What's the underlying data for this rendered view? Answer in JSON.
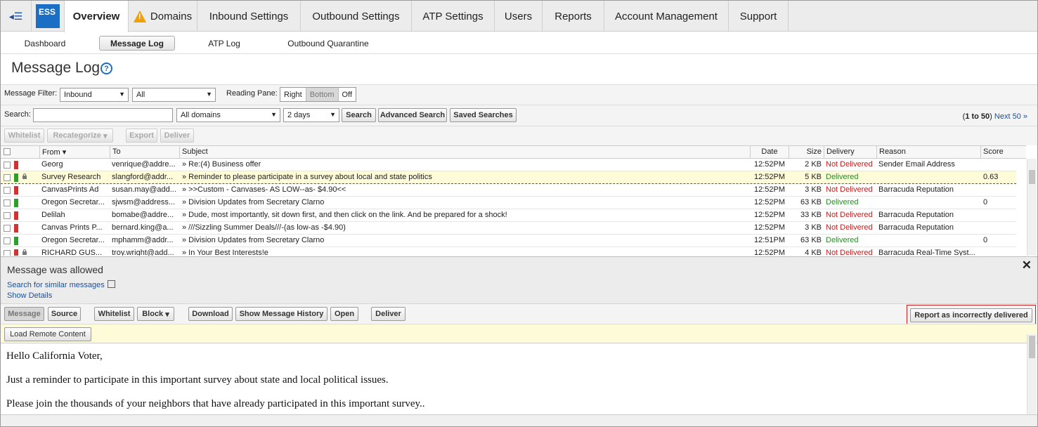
{
  "nav": {
    "logo": "ESS",
    "tabs": [
      "Overview",
      "Domains",
      "Inbound Settings",
      "Outbound Settings",
      "ATP Settings",
      "Users",
      "Reports",
      "Account Management",
      "Support"
    ]
  },
  "subnav": [
    "Dashboard",
    "Message Log",
    "ATP Log",
    "Outbound Quarantine"
  ],
  "page": {
    "title": "Message Log",
    "help": "?"
  },
  "filter": {
    "label": "Message Filter:",
    "direction": "Inbound",
    "status": "All",
    "reading_pane_label": "Reading Pane:",
    "reading_pane_options": [
      "Right",
      "Bottom",
      "Off"
    ]
  },
  "search": {
    "label": "Search:",
    "value": "",
    "domains": "All domains",
    "period": "2 days",
    "search_btn": "Search",
    "advanced_btn": "Advanced Search",
    "saved_btn": "Saved Searches",
    "range": "1 to 50",
    "next": "Next 50 »"
  },
  "actions": [
    "Whitelist",
    "Recategorize",
    "Export",
    "Deliver"
  ],
  "table": {
    "headers": [
      "From",
      "To",
      "Subject",
      "Date",
      "Size",
      "Delivery",
      "Reason",
      "Score"
    ],
    "rows": [
      {
        "from": "Georg",
        "to": "venrique@addre...",
        "subject": "» Re:(4) Business offer",
        "date": "12:52PM",
        "size": "2 KB",
        "delivery": "Not Delivered",
        "reason": "Sender Email Address",
        "score": ""
      },
      {
        "from": "Survey Research",
        "to": "slangford@addr...",
        "subject": "» Reminder to please participate in a survey about local and state politics",
        "date": "12:52PM",
        "size": "5 KB",
        "delivery": "Delivered",
        "reason": "",
        "score": "0.63"
      },
      {
        "from": "CanvasPrints Ad",
        "to": "susan.may@add...",
        "subject": "» >>Custom - Canvases- AS LOW--as- $4.90<<",
        "date": "12:52PM",
        "size": "3 KB",
        "delivery": "Not Delivered",
        "reason": "Barracuda Reputation",
        "score": ""
      },
      {
        "from": "Oregon Secretar...",
        "to": "sjwsm@address...",
        "subject": "» Division Updates from Secretary Clarno",
        "date": "12:52PM",
        "size": "63 KB",
        "delivery": "Delivered",
        "reason": "",
        "score": "0"
      },
      {
        "from": "Delilah",
        "to": "bomabe@addre...",
        "subject": "» Dude, most importantly, sit down first, and then click on the link. And be prepared for a shock!",
        "date": "12:52PM",
        "size": "33 KB",
        "delivery": "Not Delivered",
        "reason": "Barracuda Reputation",
        "score": ""
      },
      {
        "from": "Canvas Prints P...",
        "to": "bernard.king@a...",
        "subject": "» ///Sizzling Summer Deals///-(as low-as -$4.90)",
        "date": "12:52PM",
        "size": "3 KB",
        "delivery": "Not Delivered",
        "reason": "Barracuda Reputation",
        "score": ""
      },
      {
        "from": "Oregon Secretar...",
        "to": "mphamm@addr...",
        "subject": "» Division Updates from Secretary Clarno",
        "date": "12:51PM",
        "size": "63 KB",
        "delivery": "Delivered",
        "reason": "",
        "score": "0"
      },
      {
        "from": "RICHARD GUS...",
        "to": "troy.wright@add...",
        "subject": "» In Your Best Interests!e",
        "date": "12:52PM",
        "size": "4 KB",
        "delivery": "Not Delivered",
        "reason": "Barracuda Real-Time Syst...",
        "score": ""
      }
    ]
  },
  "reading_pane": {
    "status": "Message was allowed",
    "similar_link": "Search for similar messages",
    "details_link": "Show Details",
    "buttons": [
      "Message",
      "Source",
      "Whitelist",
      "Block",
      "Download",
      "Show Message History",
      "Open",
      "Deliver"
    ],
    "report_btn": "Report as incorrectly delivered",
    "load_remote": "Load Remote Content",
    "body": [
      "Hello California Voter,",
      "Just a reminder to participate in this important survey about  state and local political issues.",
      "Please join the thousands of  your neighbors that have already participated in this important survey.."
    ]
  },
  "colors": {
    "accent": "#1a6fc4",
    "danger": "#d63131",
    "ok": "#2aa02a",
    "highlight": "#fefbd9"
  }
}
